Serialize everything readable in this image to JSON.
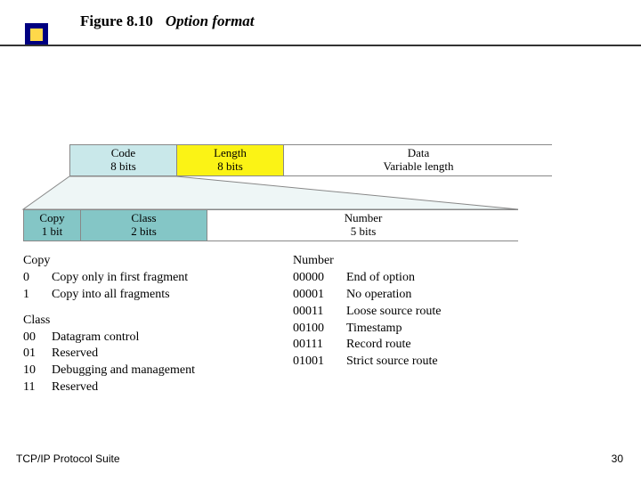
{
  "header": {
    "figure_ref": "Figure 8.10",
    "figure_title": "Option format"
  },
  "row1": {
    "code": {
      "name": "Code",
      "bits": "8 bits"
    },
    "length": {
      "name": "Length",
      "bits": "8 bits"
    },
    "data": {
      "name": "Data",
      "bits": "Variable length"
    }
  },
  "row2": {
    "copy": {
      "name": "Copy",
      "bits": "1 bit"
    },
    "class": {
      "name": "Class",
      "bits": "2 bits"
    },
    "number": {
      "name": "Number",
      "bits": "5 bits"
    }
  },
  "legend": {
    "copy": {
      "title": "Copy",
      "rows": [
        {
          "k": "0",
          "v": "Copy only in first fragment"
        },
        {
          "k": "1",
          "v": "Copy into all fragments"
        }
      ]
    },
    "class": {
      "title": "Class",
      "rows": [
        {
          "k": "00",
          "v": "Datagram control"
        },
        {
          "k": "01",
          "v": "Reserved"
        },
        {
          "k": "10",
          "v": "Debugging and management"
        },
        {
          "k": "11",
          "v": "Reserved"
        }
      ]
    },
    "number": {
      "title": "Number",
      "rows": [
        {
          "k": "00000",
          "v": "End of option"
        },
        {
          "k": "00001",
          "v": "No operation"
        },
        {
          "k": "00011",
          "v": "Loose source route"
        },
        {
          "k": "00100",
          "v": "Timestamp"
        },
        {
          "k": "00111",
          "v": "Record route"
        },
        {
          "k": "01001",
          "v": "Strict source route"
        }
      ]
    }
  },
  "footer": {
    "left": "TCP/IP Protocol Suite",
    "page": "30"
  }
}
